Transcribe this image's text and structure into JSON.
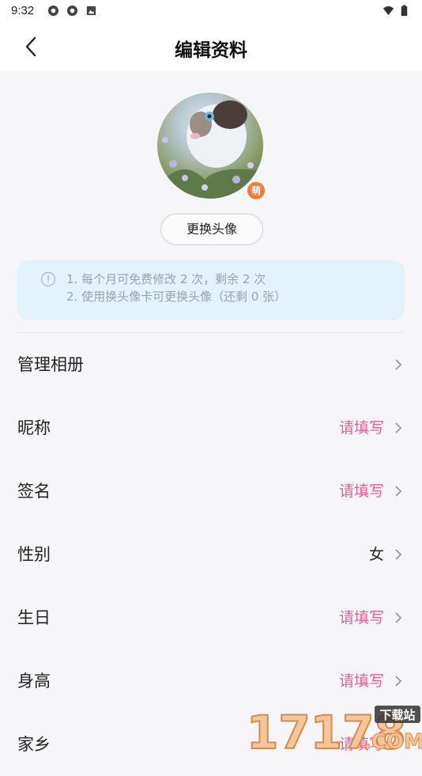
{
  "status_bar": {
    "time": "9:32"
  },
  "header": {
    "title": "编辑资料"
  },
  "avatar": {
    "badge_text": "萌",
    "change_label": "更换头像"
  },
  "notice": {
    "line1": "1. 每个月可免费修改 2 次，剩余 2 次",
    "line2": "2. 使用换头像卡可更换头像（还剩 0 张）"
  },
  "rows": [
    {
      "label": "管理相册",
      "value": ""
    },
    {
      "label": "昵称",
      "value": "请填写"
    },
    {
      "label": "签名",
      "value": "请填写"
    },
    {
      "label": "性别",
      "value": "女"
    },
    {
      "label": "生日",
      "value": "请填写"
    },
    {
      "label": "身高",
      "value": "请填写"
    },
    {
      "label": "家乡",
      "value": "请填写"
    }
  ],
  "watermark": {
    "number": "17178",
    "tag": "下载站",
    "suffix": ".COM"
  },
  "colors": {
    "placeholder": "#ef5a93",
    "notice_bg": "#e4f2fc",
    "badge": "#ff7a2f"
  }
}
